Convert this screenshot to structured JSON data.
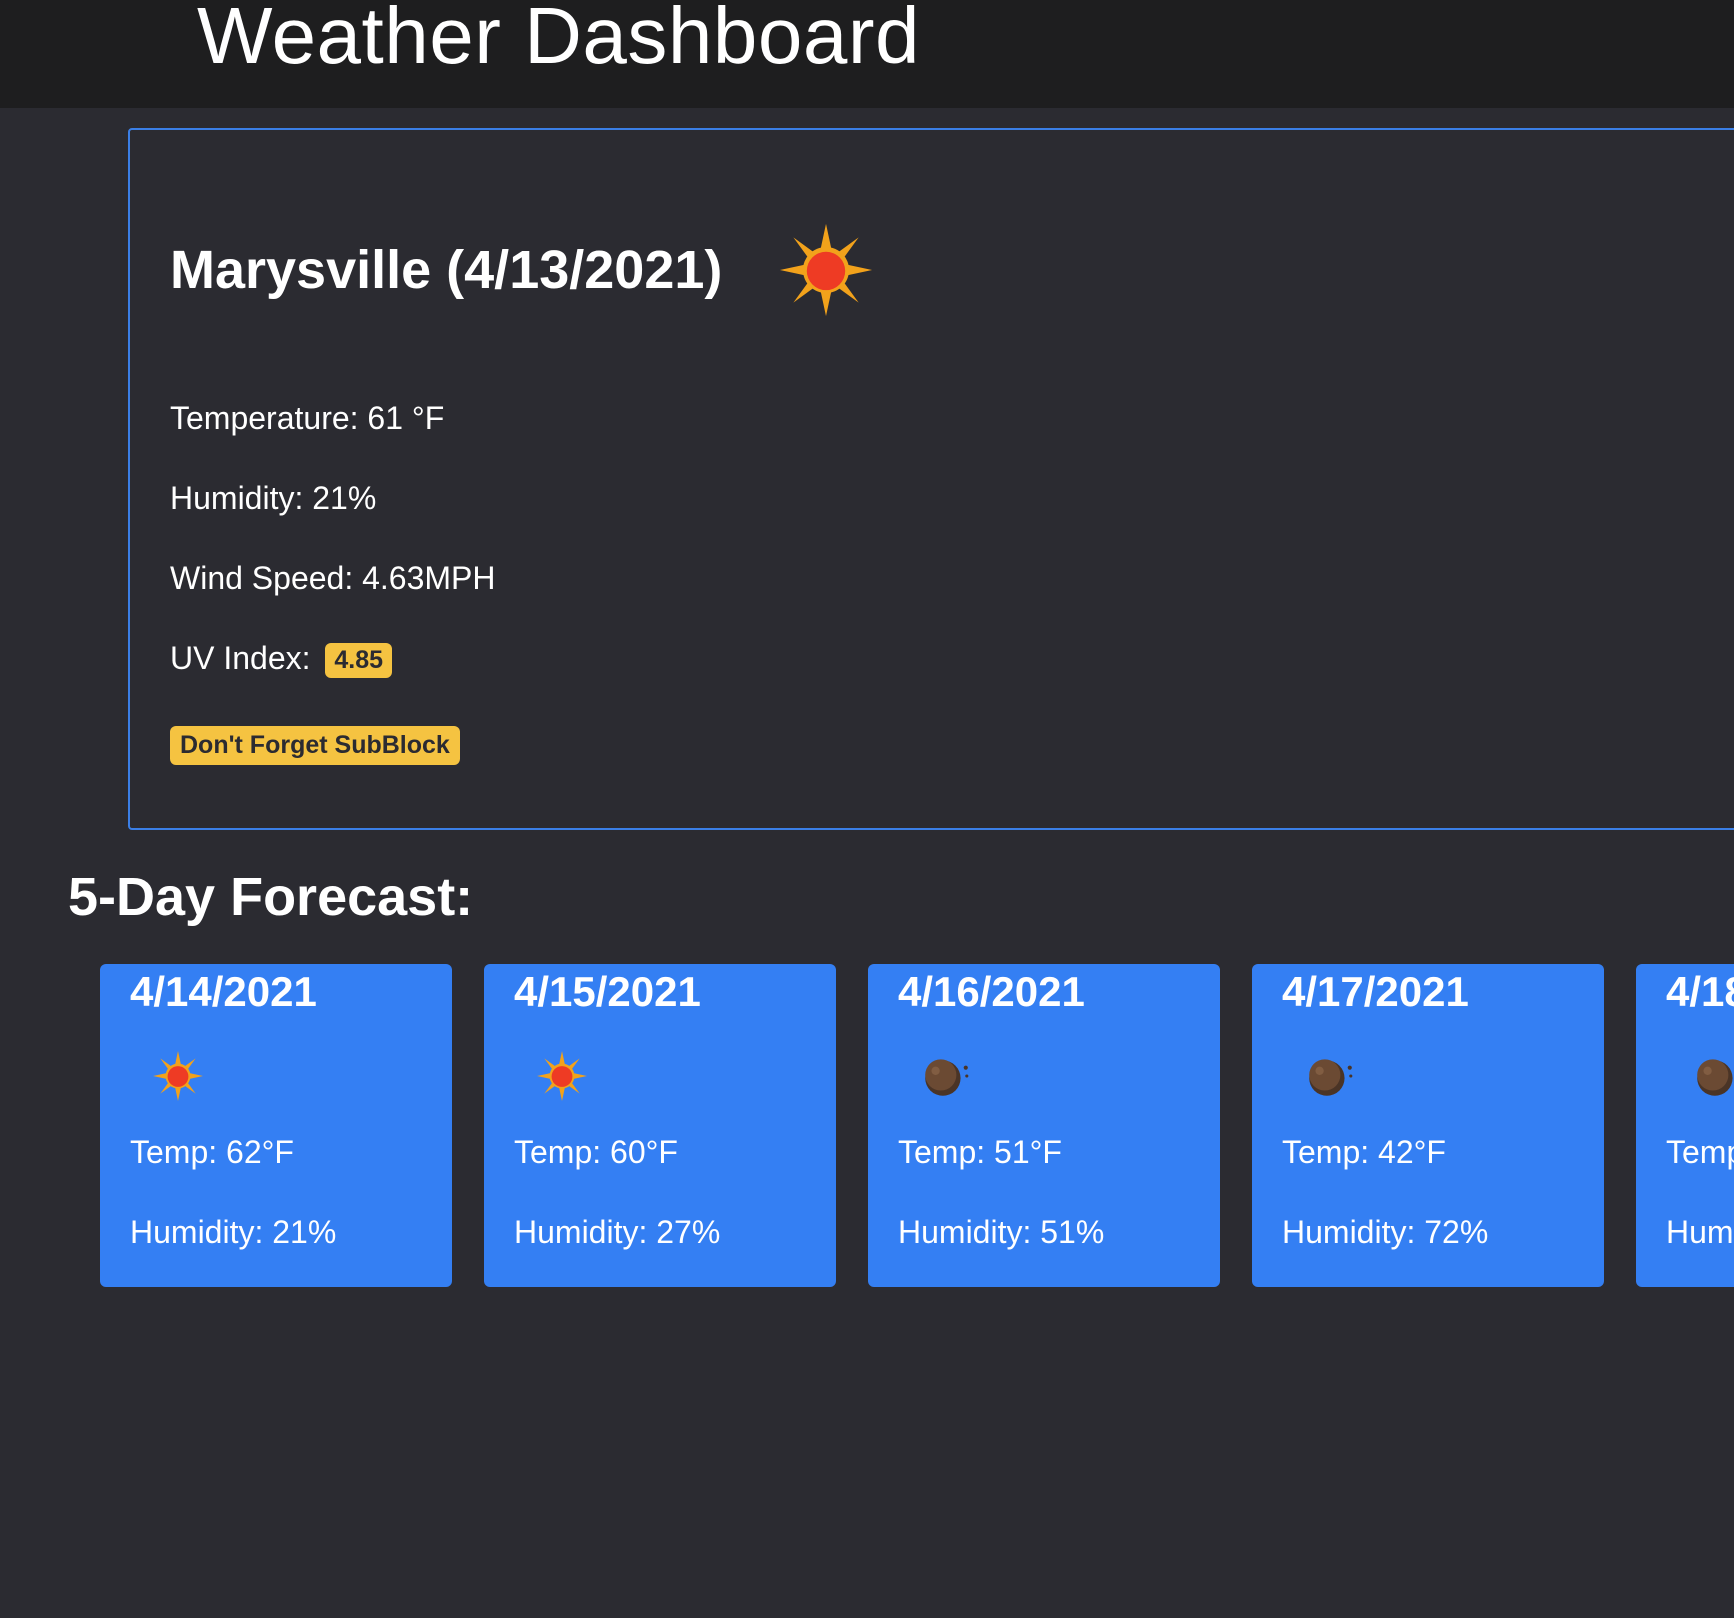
{
  "header": {
    "title": "Weather Dashboard"
  },
  "current": {
    "city_title": "Marysville (4/13/2021)",
    "icon": "sun-icon",
    "temperature": "Temperature: 61 °F",
    "humidity": "Humidity: 21%",
    "wind": "Wind Speed: 4.63MPH",
    "uv_label": "UV Index:",
    "uv_value": "4.85",
    "note": "Don't Forget SubBlock"
  },
  "forecast": {
    "title": "5-Day Forecast:",
    "days": [
      {
        "date": "4/14/2021",
        "icon": "sun-icon",
        "temp": "Temp: 62°F",
        "humidity": "Humidity: 21%"
      },
      {
        "date": "4/15/2021",
        "icon": "sun-icon",
        "temp": "Temp: 60°F",
        "humidity": "Humidity: 27%"
      },
      {
        "date": "4/16/2021",
        "icon": "moon-icon",
        "temp": "Temp: 51°F",
        "humidity": "Humidity: 51%"
      },
      {
        "date": "4/17/2021",
        "icon": "moon-icon",
        "temp": "Temp: 42°F",
        "humidity": "Humidity: 72%"
      },
      {
        "date": "4/18",
        "icon": "moon-icon",
        "temp": "Temp",
        "humidity": "Hum"
      }
    ]
  },
  "colors": {
    "background": "#2b2b31",
    "header": "#1e1e1f",
    "card_border": "#3b7fe6",
    "forecast_card": "#347ff3",
    "badge": "#f5c341"
  }
}
